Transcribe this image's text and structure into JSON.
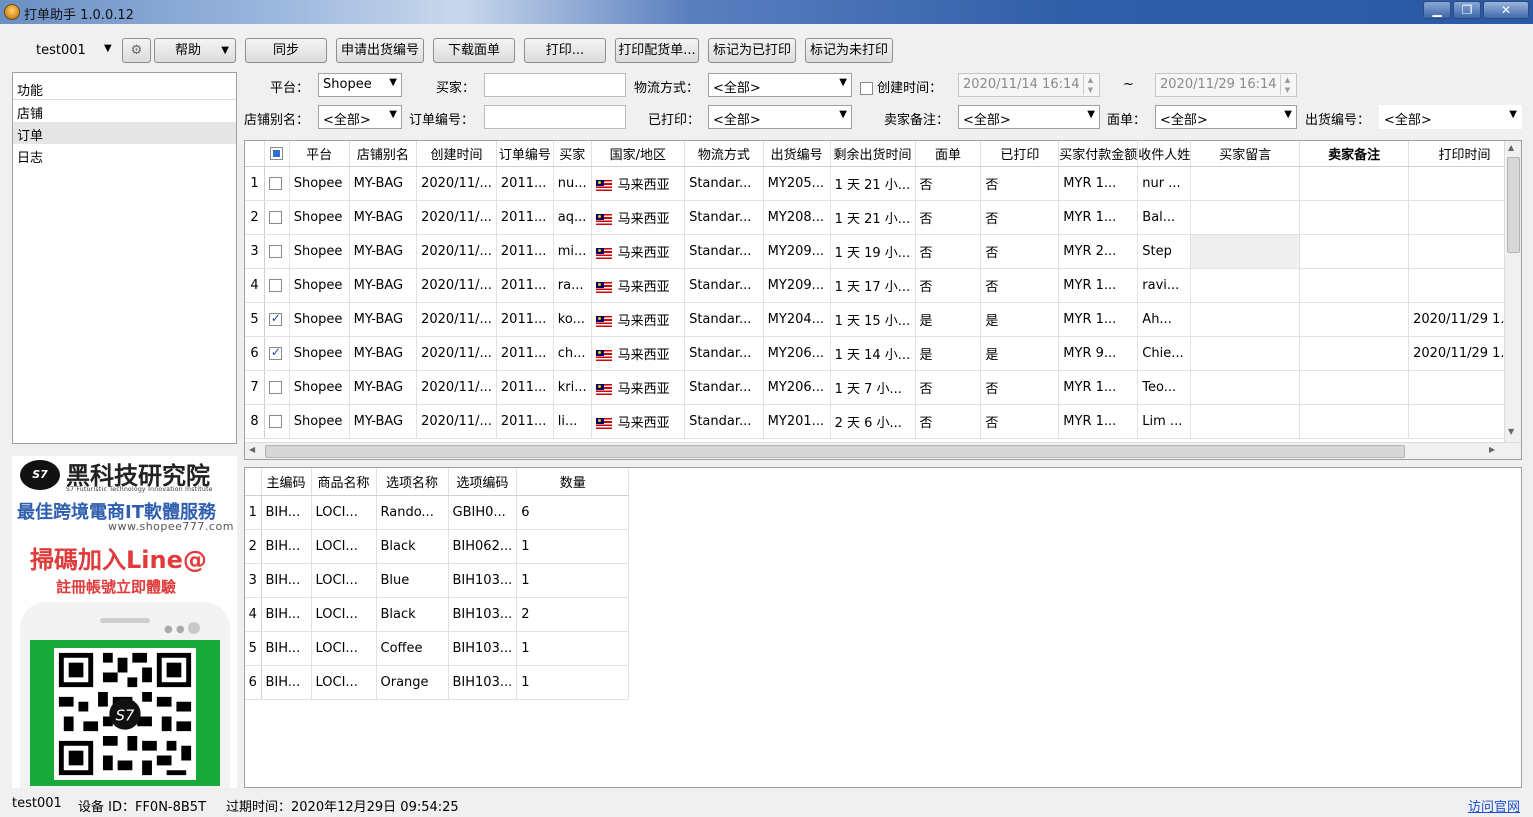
{
  "window": {
    "title": "打单助手 1.0.0.12",
    "buttons": [
      "▁",
      "❐",
      "✕"
    ]
  },
  "toolbar": {
    "user": "test001",
    "gear_icon": "gear-icon",
    "help": "帮助",
    "sync": "同步",
    "apply_shipping_no": "申请出货编号",
    "download_waybill": "下载面单",
    "print": "打印...",
    "print_picking": "打印配货单...",
    "mark_printed": "标记为已打印",
    "mark_unprinted": "标记为未打印"
  },
  "left_panel": {
    "header": "功能",
    "items": [
      "店铺",
      "订单",
      "日志"
    ],
    "selected": "订单"
  },
  "promo": {
    "logo": "S7",
    "brand": "黑科技研究院",
    "brand_sub": "S7 Futuristic Technology Innovation Institute",
    "slogan": "最佳跨境電商IT軟體服務",
    "site": "www.shopee777.com",
    "cta": "掃碼加入Line@",
    "cta2": "註冊帳號立即體驗",
    "qr_logo": "S7"
  },
  "filters": {
    "platform_label": "平台：",
    "platform_value": "Shopee",
    "buyer_label": "买家：",
    "buyer_value": "",
    "logistics_label": "物流方式：",
    "logistics_value": "<全部>",
    "created_label": "创建时间：",
    "created_checked": false,
    "date_from": "2020/11/14 16:14",
    "date_sep": "~",
    "date_to": "2020/11/29 16:14",
    "store_alias_label": "店铺别名：",
    "store_alias_value": "<全部>",
    "order_no_label": "订单编号：",
    "order_no_value": "",
    "printed_label": "已打印：",
    "printed_value": "<全部>",
    "seller_note_label": "卖家备注：",
    "seller_note_value": "<全部>",
    "waybill_label": "面单：",
    "waybill_value": "<全部>",
    "shipping_no_label": "出货编号：",
    "shipping_no_value": "<全部>"
  },
  "orders": {
    "columns": [
      "平台",
      "店铺别名",
      "创建时间",
      "订单编号",
      "买家",
      "国家/地区",
      "物流方式",
      "出货编号",
      "剩余出货时间",
      "面单",
      "已打印",
      "买家付款金额",
      "收件人姓",
      "买家留言",
      "卖家备注",
      "打印时间"
    ],
    "rows": [
      {
        "num": "1",
        "checked": false,
        "cells": [
          "Shopee",
          "MY-BAG",
          "2020/11/...",
          "2011...",
          "nu...",
          "马来西亚",
          "Standar...",
          "MY205...",
          "1 天 21 小...",
          "否",
          "否",
          "MYR 1...",
          "nur ...",
          "",
          "",
          ""
        ]
      },
      {
        "num": "2",
        "checked": false,
        "cells": [
          "Shopee",
          "MY-BAG",
          "2020/11/...",
          "2011...",
          "aq...",
          "马来西亚",
          "Standar...",
          "MY208...",
          "1 天 21 小...",
          "否",
          "否",
          "MYR 1...",
          "Bal...",
          "",
          "",
          ""
        ]
      },
      {
        "num": "3",
        "checked": false,
        "cells": [
          "Shopee",
          "MY-BAG",
          "2020/11/...",
          "2011...",
          "mi...",
          "马来西亚",
          "Standar...",
          "MY209...",
          "1 天 19 小...",
          "否",
          "否",
          "MYR 2...",
          "Step",
          "",
          "",
          ""
        ]
      },
      {
        "num": "4",
        "checked": false,
        "cells": [
          "Shopee",
          "MY-BAG",
          "2020/11/...",
          "2011...",
          "ra...",
          "马来西亚",
          "Standar...",
          "MY209...",
          "1 天 17 小...",
          "否",
          "否",
          "MYR 1...",
          "ravi...",
          "",
          "",
          ""
        ]
      },
      {
        "num": "5",
        "checked": true,
        "cells": [
          "Shopee",
          "MY-BAG",
          "2020/11/...",
          "2011...",
          "ko...",
          "马来西亚",
          "Standar...",
          "MY204...",
          "1 天 15 小...",
          "是",
          "是",
          "MYR 1...",
          "Ah...",
          "",
          "",
          "2020/11/29 1..."
        ]
      },
      {
        "num": "6",
        "checked": true,
        "cells": [
          "Shopee",
          "MY-BAG",
          "2020/11/...",
          "2011...",
          "ch...",
          "马来西亚",
          "Standar...",
          "MY206...",
          "1 天 14 小...",
          "是",
          "是",
          "MYR 9...",
          "Chie...",
          "",
          "",
          "2020/11/29 1..."
        ]
      },
      {
        "num": "7",
        "checked": false,
        "cells": [
          "Shopee",
          "MY-BAG",
          "2020/11/...",
          "2011...",
          "kri...",
          "马来西亚",
          "Standar...",
          "MY206...",
          "1 天 7 小...",
          "否",
          "否",
          "MYR 1...",
          "Teo...",
          "",
          "",
          ""
        ]
      },
      {
        "num": "8",
        "checked": false,
        "cells": [
          "Shopee",
          "MY-BAG",
          "2020/11/...",
          "2011...",
          "li...",
          "马来西亚",
          "Standar...",
          "MY201...",
          "2 天 6 小...",
          "否",
          "否",
          "MYR 1...",
          "Lim ...",
          "",
          "",
          ""
        ]
      }
    ]
  },
  "items": {
    "columns": [
      "主编码",
      "商品名称",
      "选项名称",
      "选项编码",
      "数量"
    ],
    "rows": [
      {
        "num": "1",
        "cells": [
          "BIH...",
          "LOCI...",
          "Rando...",
          "GBIH0...",
          "6"
        ]
      },
      {
        "num": "2",
        "cells": [
          "BIH...",
          "LOCI...",
          "Black",
          "BIH062...",
          "1"
        ]
      },
      {
        "num": "3",
        "cells": [
          "BIH...",
          "LOCI...",
          "Blue",
          "BIH103...",
          "1"
        ]
      },
      {
        "num": "4",
        "cells": [
          "BIH...",
          "LOCI...",
          "Black",
          "BIH103...",
          "2"
        ]
      },
      {
        "num": "5",
        "cells": [
          "BIH...",
          "LOCI...",
          "Coffee",
          "BIH103...",
          "1"
        ]
      },
      {
        "num": "6",
        "cells": [
          "BIH...",
          "LOCI...",
          "Orange",
          "BIH103...",
          "1"
        ]
      }
    ]
  },
  "status": {
    "user": "test001",
    "device": "设备 ID：FF0N-8B5T",
    "expire": "过期时间：2020年12月29日 09:54:25",
    "link": "访问官网"
  }
}
